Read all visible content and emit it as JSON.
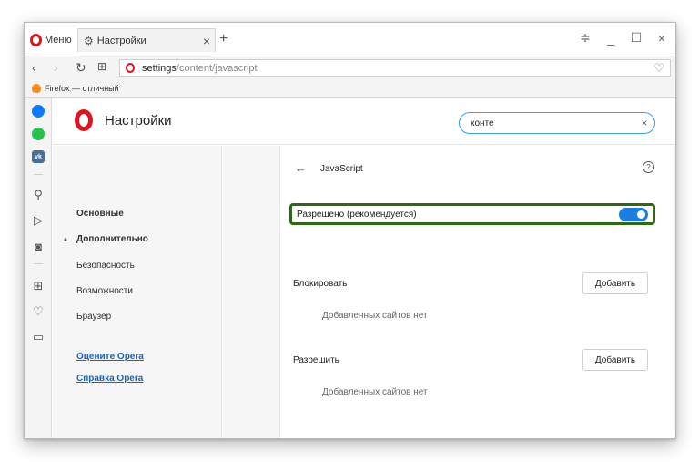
{
  "browser": {
    "menu_label": "Меню",
    "tab_title": "Настройки",
    "url_main": "settings",
    "url_rest": "/content/javascript",
    "bookmark": "Firefox — отличный"
  },
  "settings": {
    "title": "Настройки",
    "search_value": "конте"
  },
  "nav": {
    "items": [
      "Основные",
      "Дополнительно",
      "Безопасность",
      "Возможности",
      "Браузер"
    ],
    "links": [
      "Оцените Opera",
      "Справка Opera"
    ]
  },
  "content": {
    "heading": "JavaScript",
    "allowed_label": "Разрешено (рекомендуется)",
    "allowed_on": true,
    "block_title": "Блокировать",
    "allow_title": "Разрешить",
    "add_label": "Добавить",
    "empty_text": "Добавленных сайтов нет"
  },
  "colors": {
    "accent": "#1a7fe0",
    "opera_red": "#e0141e",
    "highlight_border": "#2d6a13",
    "link": "#1565c0"
  }
}
